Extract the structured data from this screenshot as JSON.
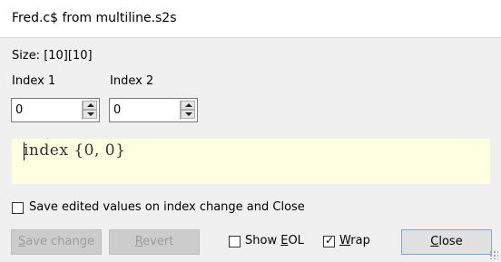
{
  "window": {
    "title": "Fred.c$ from multiline.s2s"
  },
  "size_label": "Size: [10][10]",
  "index1": {
    "label": "Index 1",
    "value": "0"
  },
  "index2": {
    "label": "Index 2",
    "value": "0"
  },
  "editor": {
    "text": "index {0, 0}",
    "background": "#ffffe1"
  },
  "save_on_change": {
    "label": "Save edited values on index change and Close",
    "checked": false
  },
  "buttons": {
    "save_change": {
      "label": "Save change",
      "mnemonic": "S",
      "rest": "ave change",
      "enabled": false
    },
    "revert": {
      "label": "Revert",
      "mnemonic": "R",
      "rest": "evert",
      "enabled": false
    },
    "close": {
      "label": "Close",
      "mnemonic": "C",
      "rest": "lose",
      "enabled": true
    }
  },
  "show_eol": {
    "label": "Show EOL",
    "pre": "Show ",
    "mnemonic": "E",
    "rest": "OL",
    "checked": false
  },
  "wrap": {
    "label": "Wrap",
    "mnemonic": "W",
    "rest": "rap",
    "checked": true
  }
}
